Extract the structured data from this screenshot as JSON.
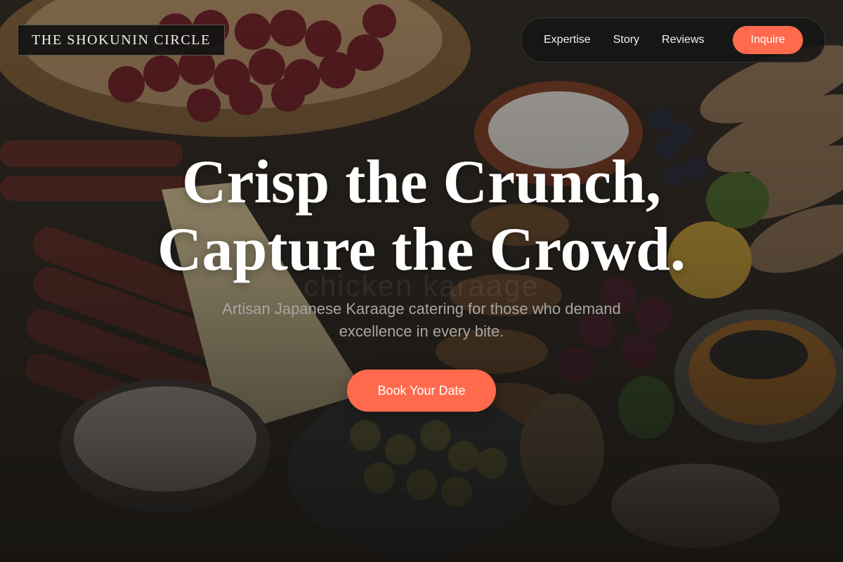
{
  "brand": {
    "name": "THE SHOKUNIN CIRCLE"
  },
  "nav": {
    "links": [
      {
        "label": "Expertise"
      },
      {
        "label": "Story"
      },
      {
        "label": "Reviews"
      }
    ],
    "cta_label": "Inquire"
  },
  "hero": {
    "headline_line1": "Crisp the Crunch,",
    "headline_line2": "Capture the Crowd.",
    "watermark": "chicken karaage",
    "subhead": "Artisan Japanese Karaage catering for those who demand excellence in every bite.",
    "cta_label": "Book Your Date"
  },
  "colors": {
    "accent": "#ff6a4d",
    "nav_bg": "#161616",
    "text": "#ffffff",
    "subtext": "#a8a6a2"
  }
}
